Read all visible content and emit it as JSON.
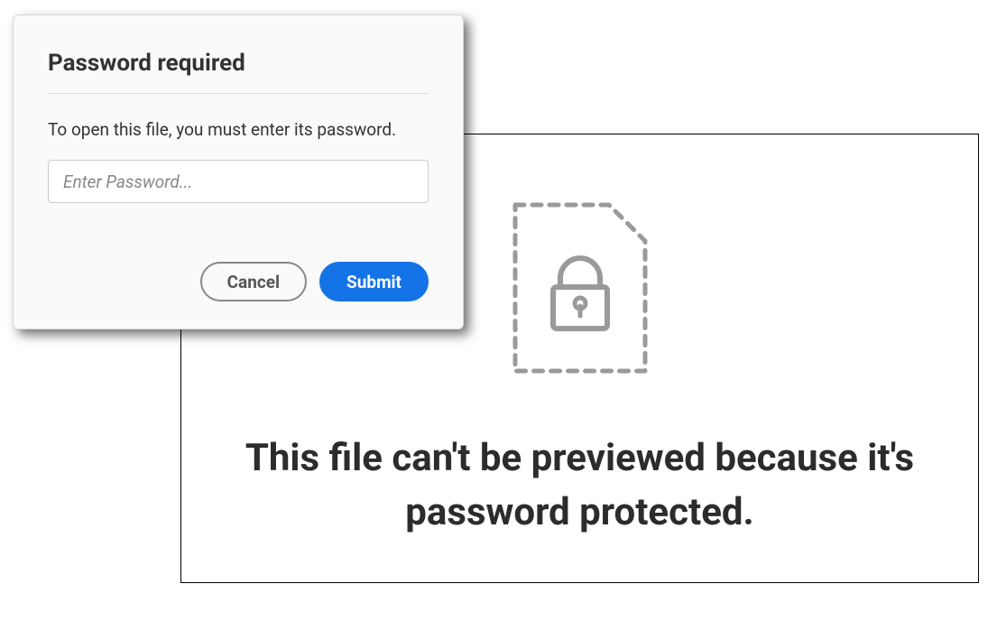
{
  "dialog": {
    "title": "Password required",
    "instruction": "To open this file, you must enter its password.",
    "password_placeholder": "Enter Password...",
    "cancel_label": "Cancel",
    "submit_label": "Submit"
  },
  "preview": {
    "message": "This file can't be previewed because it's password protected."
  },
  "colors": {
    "accent": "#1473e6",
    "icon_gray": "#9a9a9a"
  },
  "icons": {
    "locked_file": "locked-file-icon"
  }
}
